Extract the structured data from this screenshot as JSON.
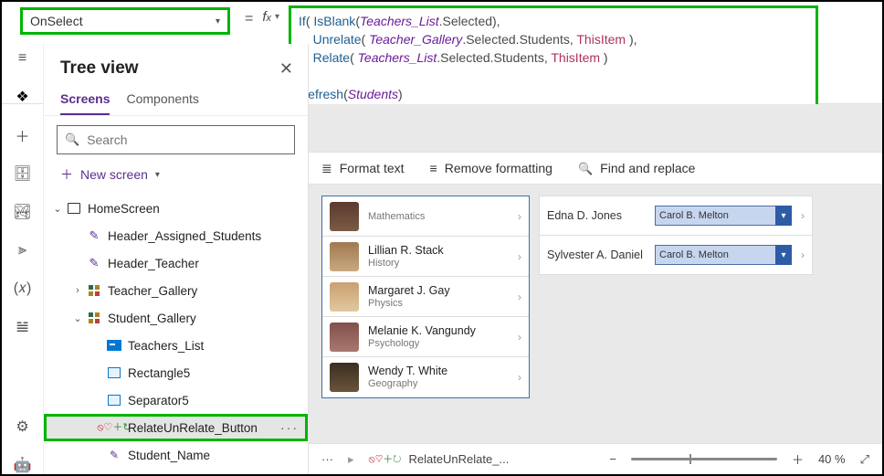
{
  "property_dropdown": {
    "value": "OnSelect"
  },
  "formula": {
    "l1a": "If",
    "l1b": "( ",
    "l1c": "IsBlank",
    "l1d": "(",
    "l1e": "Teachers_List",
    "l1f": ".Selected),",
    "l2a": "    ",
    "l2b": "Unrelate",
    "l2c": "( ",
    "l2d": "Teacher_Gallery",
    "l2e": ".Selected.Students, ",
    "l2f": "ThisItem",
    "l2g": " ),",
    "l3a": "    ",
    "l3b": "Relate",
    "l3c": "( ",
    "l3d": "Teachers_List",
    "l3e": ".Selected.Students, ",
    "l3f": "ThisItem",
    "l3g": " )",
    "l4": ");",
    "l5a": "Refresh",
    "l5b": "(",
    "l5c": "Students",
    "l5d": ")"
  },
  "tree": {
    "title": "Tree view",
    "tab_screens": "Screens",
    "tab_components": "Components",
    "search_placeholder": "Search",
    "new_screen": "New screen",
    "home": "HomeScreen",
    "n_header_assigned": "Header_Assigned_Students",
    "n_header_teacher": "Header_Teacher",
    "n_teacher_gallery": "Teacher_Gallery",
    "n_student_gallery": "Student_Gallery",
    "n_teachers_list": "Teachers_List",
    "n_rect5": "Rectangle5",
    "n_sep5": "Separator5",
    "n_relate_btn": "RelateUnRelate_Button",
    "n_student_name": "Student_Name"
  },
  "fmtbar": {
    "format": "Format text",
    "remove": "Remove formatting",
    "find": "Find and replace"
  },
  "teachers": [
    {
      "name": "",
      "sub": "Mathematics"
    },
    {
      "name": "Lillian R. Stack",
      "sub": "History"
    },
    {
      "name": "Margaret J. Gay",
      "sub": "Physics"
    },
    {
      "name": "Melanie K. Vangundy",
      "sub": "Psychology"
    },
    {
      "name": "Wendy T. White",
      "sub": "Geography"
    }
  ],
  "students": [
    {
      "name": "Edna D. Jones",
      "teacher": "Carol B. Melton"
    },
    {
      "name": "Sylvester A. Daniel",
      "teacher": "Carol B. Melton"
    }
  ],
  "status": {
    "crumb": "RelateUnRelate_...",
    "zoom": "40 %"
  }
}
